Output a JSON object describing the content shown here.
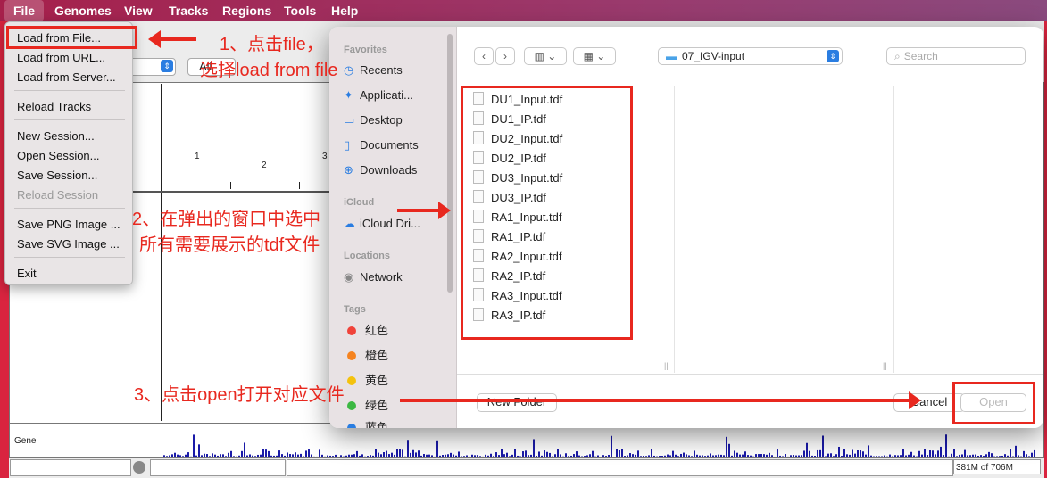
{
  "menubar": {
    "items": [
      "File",
      "Genomes",
      "View",
      "Tracks",
      "Regions",
      "Tools",
      "Help"
    ]
  },
  "igv": {
    "locus_select": "All",
    "ruler_ticks": [
      "1",
      "2",
      "3"
    ],
    "track_label": "Gene",
    "memory": "381M of 706M"
  },
  "file_menu": {
    "items": [
      {
        "label": "Load from File...",
        "enabled": true
      },
      {
        "label": "Load from URL...",
        "enabled": true
      },
      {
        "label": "Load from Server...",
        "enabled": true
      },
      {
        "label": "Reload Tracks",
        "enabled": true
      },
      {
        "label": "New Session...",
        "enabled": true
      },
      {
        "label": "Open Session...",
        "enabled": true
      },
      {
        "label": "Save Session...",
        "enabled": true
      },
      {
        "label": "Reload Session",
        "enabled": false
      },
      {
        "label": "Save PNG Image ...",
        "enabled": true
      },
      {
        "label": "Save SVG Image ...",
        "enabled": true
      },
      {
        "label": "Exit",
        "enabled": true
      }
    ]
  },
  "dialog": {
    "sidebar": {
      "favorites_header": "Favorites",
      "favorites": [
        {
          "label": "Recents",
          "icon": "clock-icon"
        },
        {
          "label": "Applicati...",
          "icon": "applications-icon"
        },
        {
          "label": "Desktop",
          "icon": "desktop-icon"
        },
        {
          "label": "Documents",
          "icon": "document-icon"
        },
        {
          "label": "Downloads",
          "icon": "download-icon"
        }
      ],
      "icloud_header": "iCloud",
      "icloud": [
        {
          "label": "iCloud Dri...",
          "icon": "cloud-icon"
        }
      ],
      "locations_header": "Locations",
      "locations": [
        {
          "label": "Network",
          "icon": "network-icon"
        }
      ],
      "tags_header": "Tags",
      "tags": [
        {
          "label": "红色",
          "color": "#f0433a"
        },
        {
          "label": "橙色",
          "color": "#f5831f"
        },
        {
          "label": "黄色",
          "color": "#f4c20d"
        },
        {
          "label": "绿色",
          "color": "#3cb843"
        },
        {
          "label": "蓝色",
          "color": "#2a7de1"
        }
      ]
    },
    "folder": "07_IGV-input",
    "search_placeholder": "Search",
    "files": [
      "DU1_Input.tdf",
      "DU1_IP.tdf",
      "DU2_Input.tdf",
      "DU2_IP.tdf",
      "DU3_Input.tdf",
      "DU3_IP.tdf",
      "RA1_Input.tdf",
      "RA1_IP.tdf",
      "RA2_Input.tdf",
      "RA2_IP.tdf",
      "RA3_Input.tdf",
      "RA3_IP.tdf"
    ],
    "new_folder": "New Folder",
    "cancel": "Cancel",
    "open": "Open"
  },
  "annotations": {
    "step1": "1、点击file，",
    "step1b": "选择load from file",
    "step2": "2、在弹出的窗口中选中",
    "step2b": "所有需要展示的tdf文件",
    "step3": "3、点击open打开对应文件"
  },
  "colors": {
    "annotation": "#e8281f",
    "accent": "#2a7de1"
  }
}
